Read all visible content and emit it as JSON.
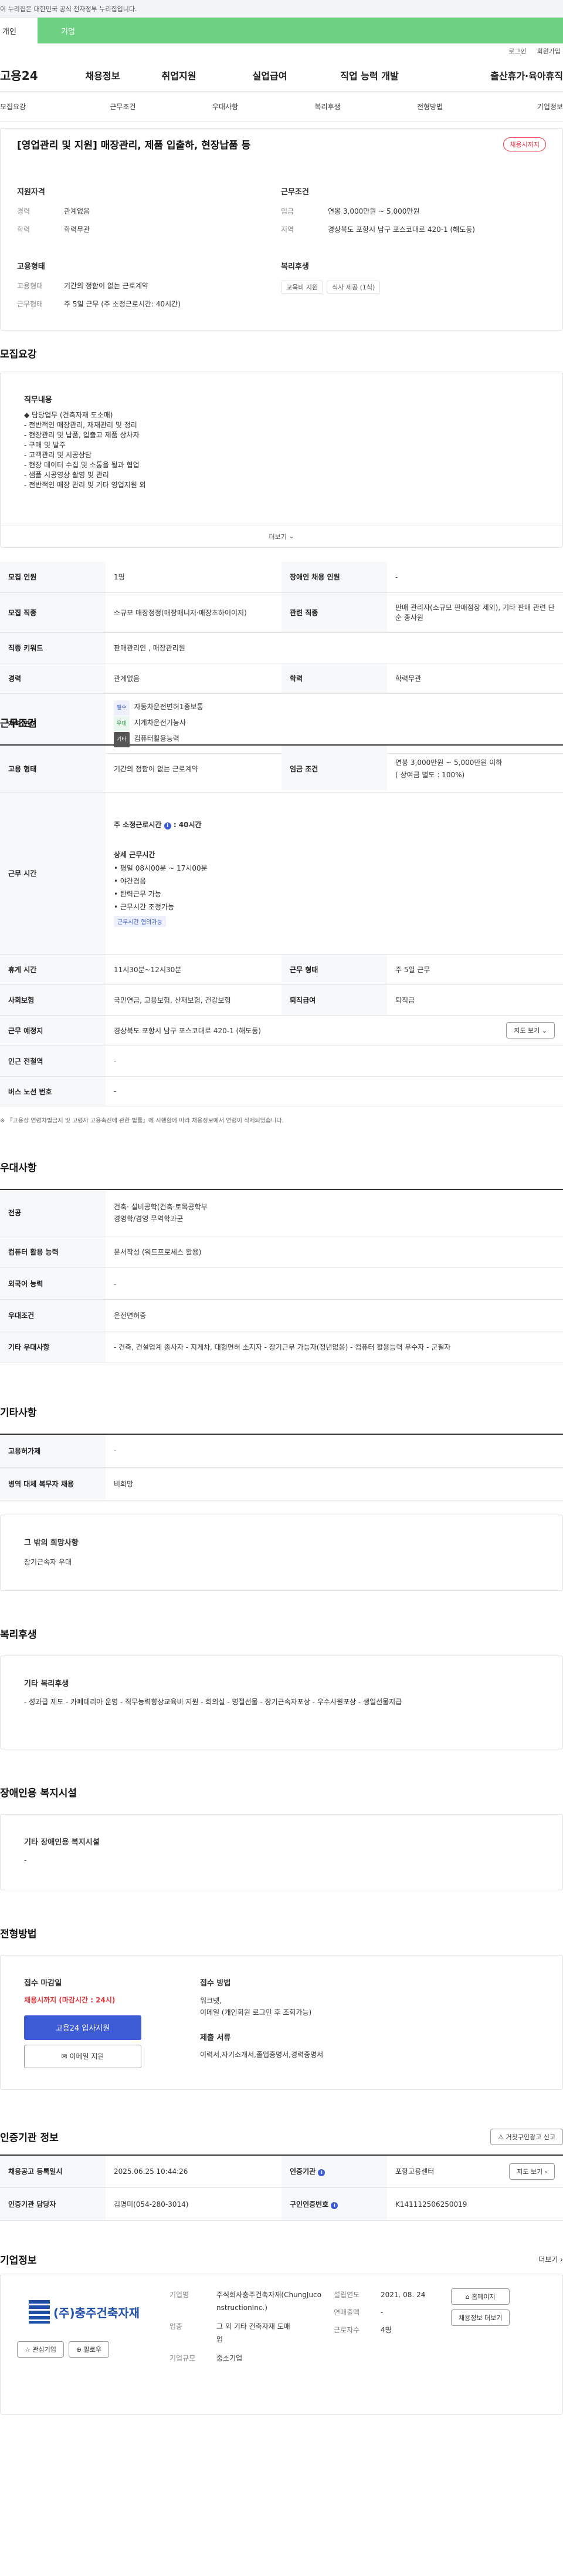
{
  "gov_banner": "이 누리집은 대한민국 공식 전자정부 누리집입니다.",
  "user_tabs": [
    "개인",
    "기업"
  ],
  "util": [
    "로그인",
    "회원가입"
  ],
  "logo": "고용24",
  "gnb": [
    "채용정보",
    "취업지원",
    "실업급여",
    "직업 능력 개발",
    "출산휴가·육아휴직"
  ],
  "lnb": [
    "모집요강",
    "근무조건",
    "우대사항",
    "복리후생",
    "전형방법",
    "기업정보"
  ],
  "job": {
    "title": "[영업관리 및 지원] 매장관리, 제품 입출하, 현장납품 등",
    "status": "채용시까지",
    "qual_title": "지원자격",
    "cond_title": "근무조건",
    "career_label": "경력",
    "career": "관계없음",
    "edu_label": "학력",
    "edu": "학력무관",
    "wage_label": "임금",
    "wage": "연봉 3,000만원 ~ 5,000만원",
    "region_label": "지역",
    "region": "경상북도 포항시 남구 포스코대로 420-1 (해도동)",
    "emp_title": "고용형태",
    "emp_label": "고용형태",
    "emp": "기간의 정함이 없는 근로계약",
    "hours_label": "근무형태",
    "hours": "주 5일 근무 (주 소정근로시간: 40시간)",
    "welfare_title": "복리후생",
    "welfare_chips": [
      "교육비 지원",
      "식사 제공 (1식)"
    ]
  },
  "recruit": {
    "title": "모집요강",
    "duty_title": "직무내용",
    "duty_lines": [
      "◆ 담당업무 (건축자재 도소매)",
      "- 전반적인 매장관리, 재재관리 및 정리",
      "- 현장관리 및 납품, 입출고 제품 상차자",
      "- 구매 및 발주",
      "- 고객관리 및 시공상담",
      "- 현장 데이터 수집 및 소통을 될과 협업",
      "- 샘플 시공영상 촬영 및 관리",
      "- 전반적인 매장 관리 및 기타 영업지원 외"
    ],
    "more": "더보기",
    "rows": [
      {
        "h1": "모집 인원",
        "v1": "1명",
        "h2": "장애인 채용 인원",
        "v2": "-"
      },
      {
        "h1": "모집 직종",
        "v1": "소규모 매장정정(매장매니저·매장초하어이저)",
        "h2": "관련 직종",
        "v2": "판매 관리자(소규모 판매점장 제외), 기타 판매 관련 단순 종사원"
      },
      {
        "h1": "직종 키워드",
        "v1": "판매관리인 , 매장관리원"
      },
      {
        "h1": "경력",
        "v1": "관계없음",
        "h2": "학력",
        "v2": "학력무관"
      }
    ],
    "license_label": "자격 면허",
    "licenses": [
      {
        "tag": "필수",
        "name": "자동차운전면허1종보통"
      },
      {
        "tag": "우대",
        "name": "지게차운전기능사"
      },
      {
        "tag": "기타",
        "name": "컴퓨터활용능력"
      }
    ]
  },
  "work": {
    "title": "근무조건",
    "emp_label": "고용 형태",
    "emp": "기간의 정함이 없는 근로계약",
    "wage_label": "임금 조건",
    "wage": "연봉 3,000만원 ~ 5,000만원 이하",
    "wage_sub": "( 상여금 별도 : 100%)",
    "time_label": "근무 시간",
    "time_head": "주 소정근로시간",
    "time_hours": "40시간",
    "detail_title": "상세 근무시간",
    "detail": [
      "• 평일 08시00분 ~ 17시00분",
      "• 야간겸음",
      "• 탄력근무 가능",
      "• 근무시간 조정가능"
    ],
    "detail_tag": "근무시간 협의가능",
    "rows": [
      {
        "h1": "휴게 시간",
        "v1": "11시30분~12시30분",
        "h2": "근무 형태",
        "v2": "주 5일 근무"
      },
      {
        "h1": "사회보험",
        "v1": "국민연금, 고용보험, 산재보험, 건강보험",
        "h2": "퇴직급여",
        "v2": "퇴직금"
      }
    ],
    "place_label": "근무 예정지",
    "place": "경상북도 포항시 남구 포스코대로 420-1 (해도동)",
    "map_btn": "지도 보기",
    "station_label": "인근 전철역",
    "station": "-",
    "bus_label": "버스 노선 번호",
    "bus": "-",
    "note": "※ 『고용상 연령차별금지 및 고령자 고용촉진에 관한 법률』에 시행함에 따라 채용정보에서 연령이 삭제되었습니다."
  },
  "pref": {
    "title": "우대사항",
    "rows": [
      {
        "h": "전공",
        "v": "건축· 설비공학(건축·토목공학부\n경영학/경영 무역학과군"
      },
      {
        "h": "컴퓨터 활용 능력",
        "v": "문서작성 (워드프로세스 활용)"
      },
      {
        "h": "외국어 능력",
        "v": "-"
      },
      {
        "h": "우대조건",
        "v": "운전면허증"
      },
      {
        "h": "기타 우대사항",
        "v": "- 건축, 건설업계 종사자   - 지게차, 대형면허 소지자   - 장기근무 가능자(정년없음)   - 컴퓨터 활용능력 우수자   - 군필자"
      }
    ]
  },
  "etc": {
    "title": "기타사항",
    "rows": [
      {
        "h": "고용허가제",
        "v": "-"
      },
      {
        "h": "병역 대체 복무자 채용",
        "v": "비희망"
      }
    ],
    "wish_title": "그 밖의 희망사항",
    "wish": "장기근속자 우대"
  },
  "benefit": {
    "title": "복리후생",
    "sub": "기타 복리후생",
    "text": "- 성과급 제도   - 카페테리아 운영   - 직무능력향상교육비 지원   - 회의실   - 명절선물   - 장기근속자포상   - 우수사원포상   - 생일선물지급"
  },
  "disab": {
    "title": "장애인용 복지시설",
    "sub": "기타 장애인용 복지시설",
    "text": "-"
  },
  "proc": {
    "title": "전형방법",
    "deadline_label": "접수 마감일",
    "deadline": "채용시까지 (마감시간 : 24시)",
    "apply_btn": "고용24 입사지원",
    "email_btn": "이메일 지원",
    "method_label": "접수 방법",
    "method": "워크넷,\n이메일 (개인회원 로그인 후 조회가능)",
    "docs_label": "제출 서류",
    "docs": "이력서,자기소개서,졸업증명서,경력증명서"
  },
  "cert": {
    "title": "인증기관 정보",
    "report_btn": "거짓구인광고 신고",
    "reg_label": "채용공고 등록일시",
    "reg": "2025.06.25 10:44:26",
    "org_label": "인증기관",
    "org": "포항고용센터",
    "org_btn": "지도 보기",
    "manager_label": "인증기관 담당자",
    "manager": "김명미(054-280-3014)",
    "num_label": "구인인증번호",
    "num": "K141112506250019"
  },
  "company": {
    "title": "기업정보",
    "more": "더보기",
    "logo_text": "(주)충주건축자재",
    "fav_btn": "관심기업",
    "follow_btn": "팔로우",
    "name_label": "기업명",
    "name": "주식회사충주건축자재(ChungJuconstructionInc.)",
    "est_label": "설립연도",
    "est": "2021. 08. 24",
    "hp_btn": "홈페이지",
    "emp_btn": "채용정보 더보기",
    "sales_label": "연매출액",
    "sales": "-",
    "staff_label": "근로자수",
    "staff": "4명",
    "biz_label": "업종",
    "biz": "그 외 기타 건축자재 도매업",
    "size_label": "기업규모",
    "size": "중소기업"
  }
}
